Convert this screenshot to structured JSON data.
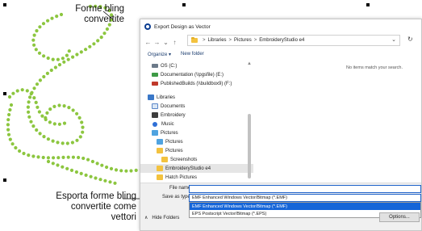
{
  "callouts": {
    "top_line1": "Forme bling",
    "top_line2": "convertite",
    "bottom_line1": "Esporta forme bling",
    "bottom_line2": "convertite come",
    "bottom_line3": "vettori"
  },
  "colors": {
    "bling_dot": "#8cc63f",
    "accent": "#1565d8"
  },
  "dialog": {
    "title": "Export Design as Vector",
    "nav": {
      "back": "←",
      "forward": "→",
      "dropdown": "⌄",
      "up": "↑",
      "refresh": "↻"
    },
    "breadcrumb": [
      "Libraries",
      "Pictures",
      "EmbroideryStudio e4"
    ],
    "breadcrumb_sep": ">",
    "address_chevron": "⌄",
    "commands": {
      "organize": "Organize ▾",
      "new_folder": "New folder"
    },
    "empty_message": "No items match your search.",
    "tree": [
      {
        "label": "OS (C:)",
        "icon": "drive-icon"
      },
      {
        "label": "Documentation (\\\\pgsfile) (E:)",
        "icon": "network-drive-icon"
      },
      {
        "label": "PublishedBuilds (\\\\buildbox9) (F:)",
        "icon": "network-drive-icon"
      },
      {
        "label": "",
        "icon": ""
      },
      {
        "label": "Libraries",
        "icon": "libraries-icon"
      },
      {
        "label": "Documents",
        "icon": "documents-icon"
      },
      {
        "label": "Embroidery",
        "icon": "embroidery-icon"
      },
      {
        "label": "Music",
        "icon": "music-icon"
      },
      {
        "label": "Pictures",
        "icon": "pictures-icon"
      },
      {
        "label": "Pictures",
        "icon": "pictures-icon"
      },
      {
        "label": "Pictures",
        "icon": "folder-icon"
      },
      {
        "label": "Screenshots",
        "icon": "folder-icon"
      },
      {
        "label": "EmbroideryStudio e4",
        "icon": "folder-icon",
        "selected": true
      },
      {
        "label": "Hatch Pictures",
        "icon": "folder-icon"
      }
    ],
    "form": {
      "file_name_label": "File name:",
      "file_name_value": "",
      "save_as_type_label": "Save as type:",
      "save_as_type_value": "EMF Enhanced Windows Vector/Bitmap (*.EMF)",
      "type_options": [
        {
          "label": "EMF Enhanced Windows Vector/Bitmap (*.EMF)",
          "selected": true
        },
        {
          "label": "EPS Postscript Vector/Bitmap (*.EPS)",
          "selected": false
        }
      ],
      "hide_folders": "Hide Folders",
      "hide_folders_chevron": "∧",
      "options_button": "Options..."
    }
  }
}
